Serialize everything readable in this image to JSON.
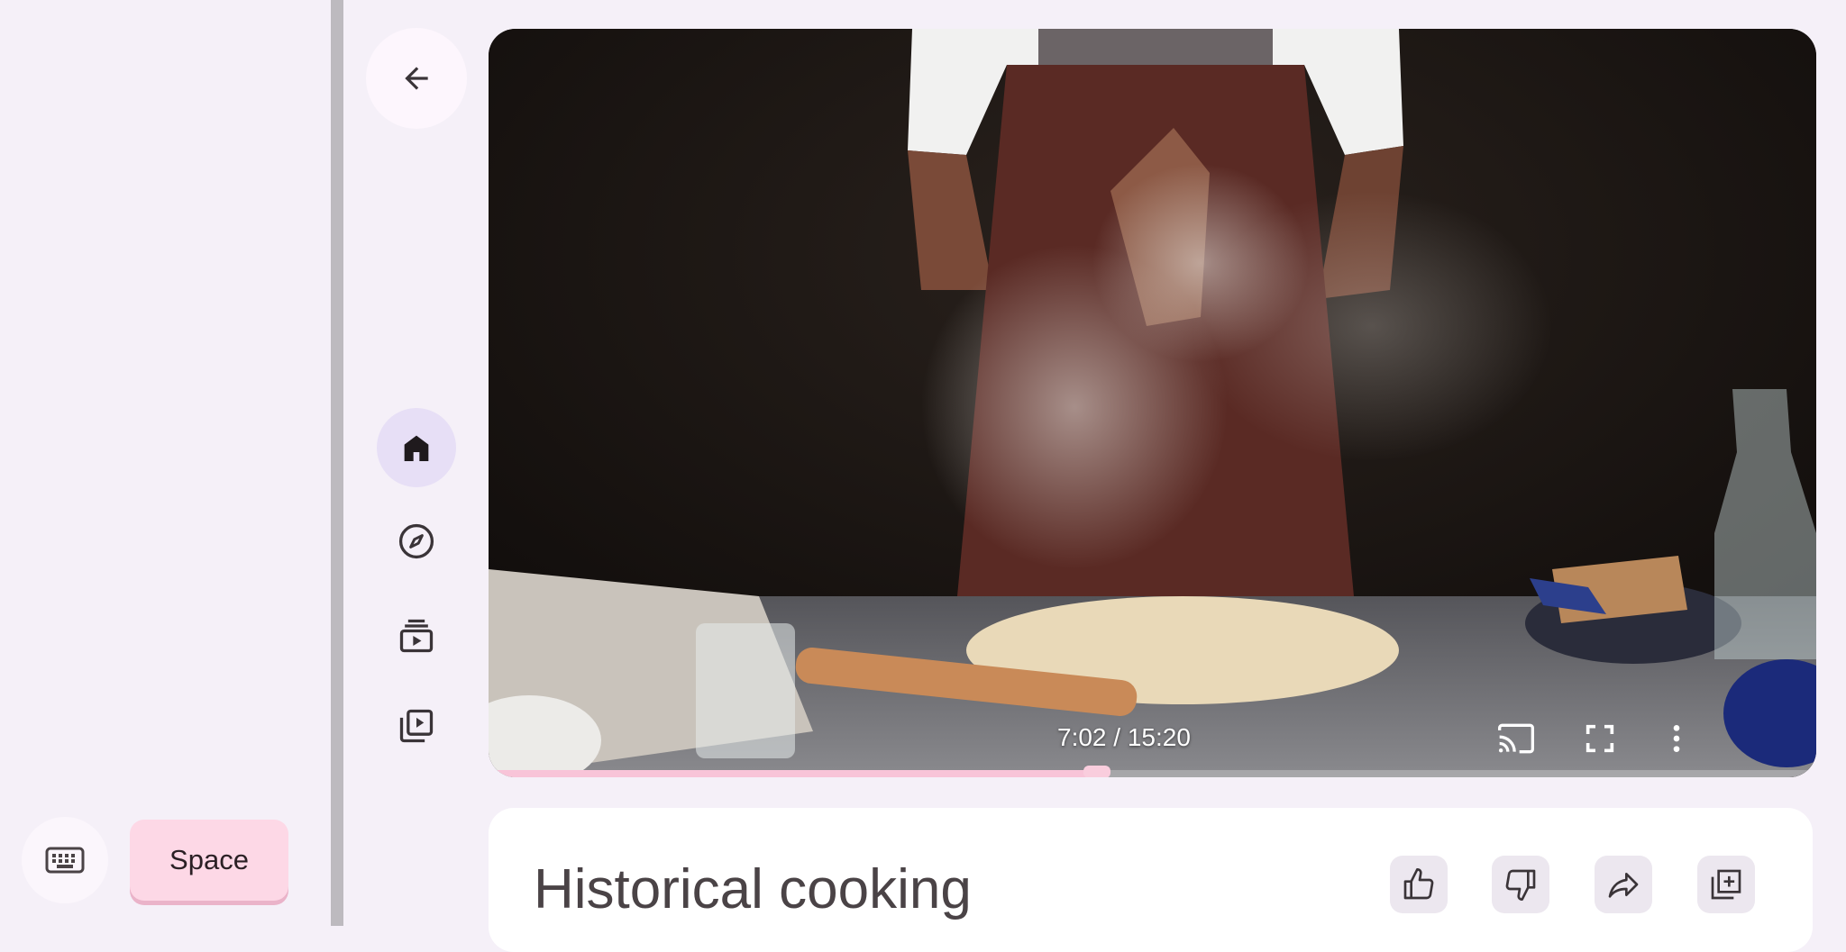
{
  "keyboard": {
    "icon": "keyboard-icon",
    "space_label": "Space"
  },
  "nav": {
    "back_icon": "back-arrow-icon",
    "items": [
      {
        "icon": "home-icon",
        "active": true
      },
      {
        "icon": "explore-icon",
        "active": false
      },
      {
        "icon": "subscriptions-icon",
        "active": false
      },
      {
        "icon": "library-icon",
        "active": false
      }
    ]
  },
  "player": {
    "current_time": "7:02",
    "duration": "15:20",
    "time_display": "7:02 / 15:20",
    "progress_fraction": 0.458,
    "controls": [
      "cast-icon",
      "fullscreen-icon",
      "more-vert-icon"
    ],
    "colors": {
      "progress": "#f8c4d8",
      "progress_knob": "#f9cddd"
    }
  },
  "video": {
    "title": "Historical cooking",
    "actions": [
      "like-icon",
      "dislike-icon",
      "share-icon",
      "save-to-playlist-icon"
    ]
  },
  "colors": {
    "background": "#f5f0f8",
    "space_button": "#fdd8e6",
    "nav_active": "#e7dff6",
    "divider": "#bdbabf"
  }
}
